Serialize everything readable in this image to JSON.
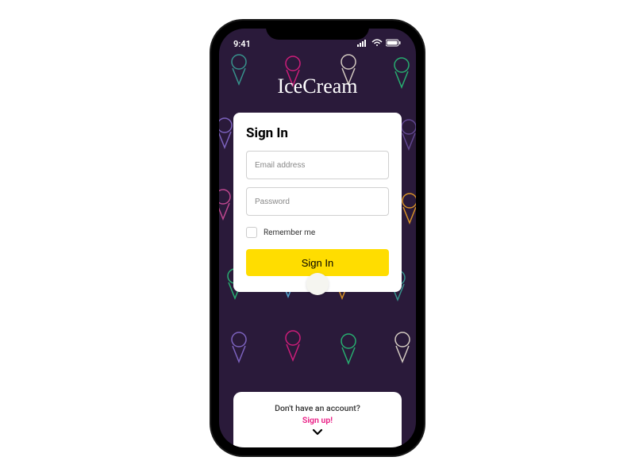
{
  "status_bar": {
    "time": "9:41"
  },
  "app": {
    "title": "IceCream"
  },
  "signin_card": {
    "title": "Sign In",
    "email_placeholder": "Email address",
    "password_placeholder": "Password",
    "remember_label": "Remember me",
    "button_label": "Sign In"
  },
  "footer": {
    "prompt": "Don't have an account?",
    "signup_label": "Sign up!"
  },
  "colors": {
    "accent_yellow": "#ffdd00",
    "accent_pink": "#e91e85",
    "bg_dark": "#2a1a3a"
  },
  "cone_colors": [
    "#3aa89b",
    "#e91e85",
    "#f0e8d8",
    "#27c77a",
    "#8b6fd6",
    "#f5a623",
    "#5bc0eb",
    "#d94f9e",
    "#6b4fa0"
  ]
}
